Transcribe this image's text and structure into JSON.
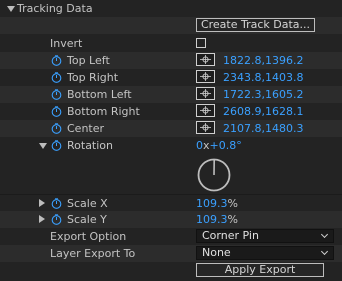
{
  "section": {
    "title": "Tracking Data"
  },
  "create_track_button": "Create Track Data...",
  "invert": {
    "label": "Invert",
    "checked": false
  },
  "points": [
    {
      "label": "Top Left",
      "value": "1822.8,1396.2"
    },
    {
      "label": "Top Right",
      "value": "2343.8,1403.8"
    },
    {
      "label": "Bottom Left",
      "value": "1722.3,1605.2"
    },
    {
      "label": "Bottom Right",
      "value": "2608.9,1628.1"
    },
    {
      "label": "Center",
      "value": "2107.8,1480.3"
    }
  ],
  "rotation": {
    "label": "Rotation",
    "revolutions": "0",
    "x_sep": "x",
    "degrees": "+0.8",
    "deg_symbol": "°",
    "angle_deg": 0.8
  },
  "scale_x": {
    "label": "Scale X",
    "value": "109.3",
    "unit": "%"
  },
  "scale_y": {
    "label": "Scale Y",
    "value": "109.3",
    "unit": "%"
  },
  "export_option": {
    "label": "Export Option",
    "selected": "Corner Pin"
  },
  "layer_export": {
    "label": "Layer Export To",
    "selected": "None"
  },
  "apply_export_button": "Apply Export",
  "colors": {
    "accent": "#3aa0ff",
    "background": "#232323",
    "alt_row": "#2c2c2c"
  },
  "icons": [
    "disclosure-triangle-icon",
    "stopwatch-icon",
    "crosshair-icon",
    "chevron-down-icon"
  ]
}
